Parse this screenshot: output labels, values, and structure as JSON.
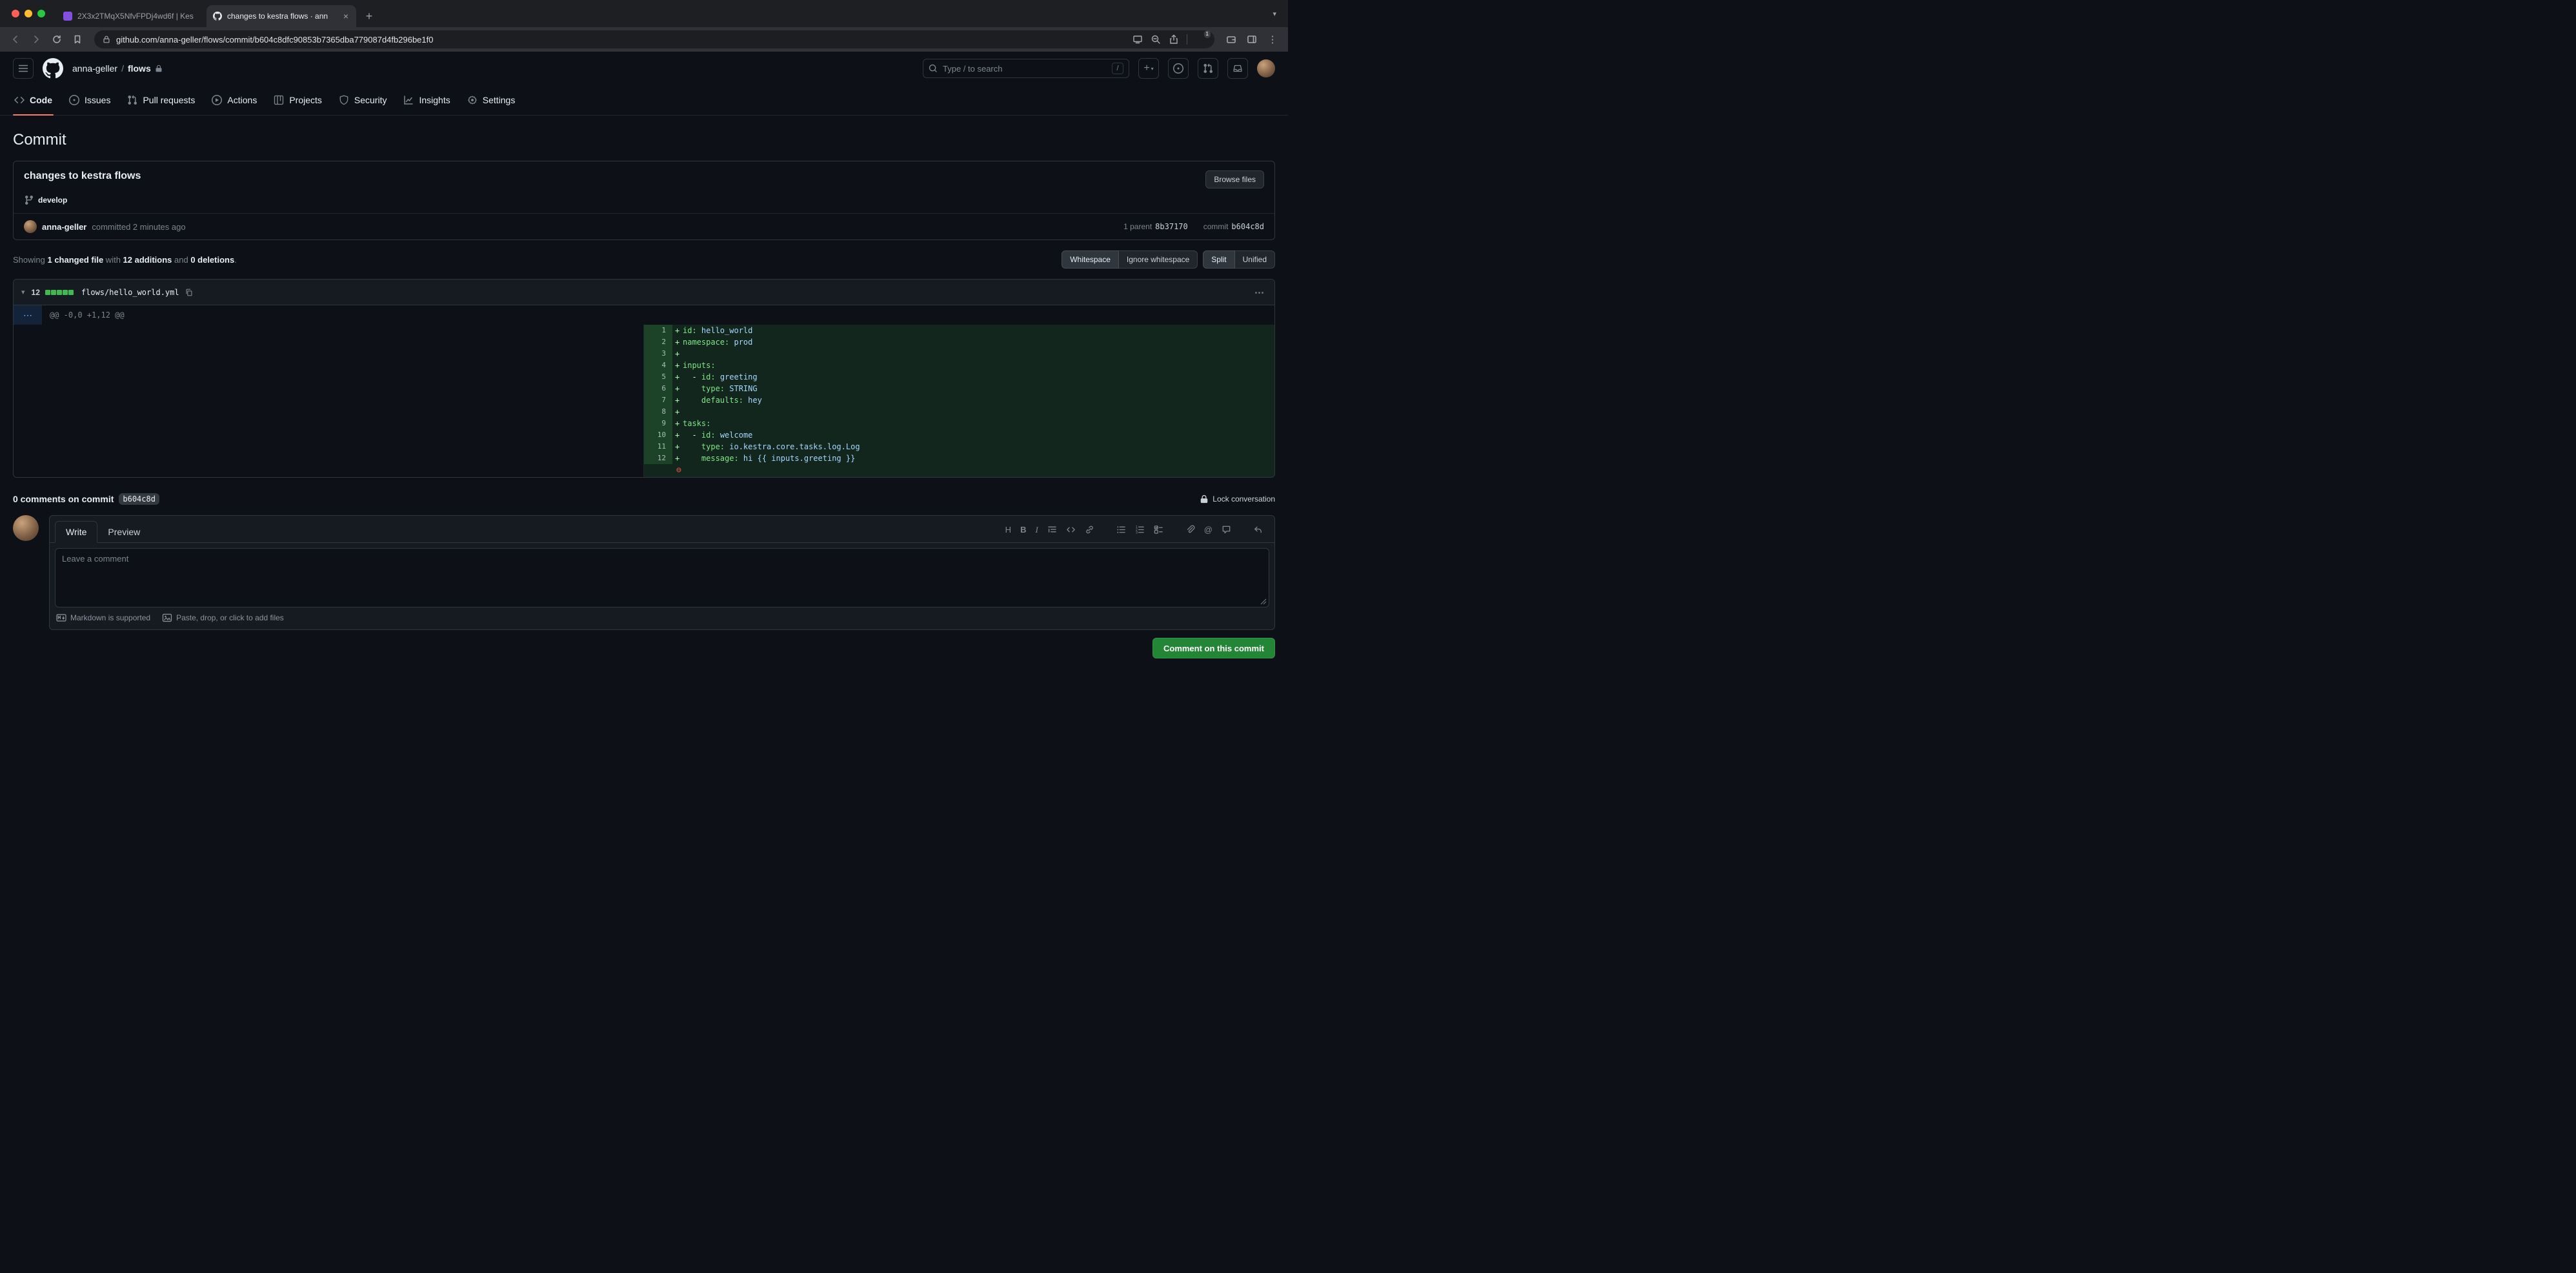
{
  "browser": {
    "tab1_title": "2X3x2TMqX5NfvFPDj4wd6f | Kes",
    "tab2_title": "changes to kestra flows · ann",
    "url": "github.com/anna-geller/flows/commit/b604c8dfc90853b7365dba779087d4fb296be1f0",
    "shields_badge": "1"
  },
  "icons": {
    "new_tab": "+",
    "tab_close": "×",
    "tabstrip_chevron": "▾",
    "overflow_menu": "⋮",
    "kebab": "⋯",
    "hunk_expand": "⋯",
    "collapse_chevron": "▾",
    "plus": "+",
    "caret_down": "▾",
    "no_newline": "⊖",
    "heading": "H",
    "bold": "B",
    "italic": "I",
    "mention": "@"
  },
  "gh_header": {
    "owner": "anna-geller",
    "sep": "/",
    "repo": "flows",
    "search_placeholder": "Type / to search",
    "search_kbd": "/"
  },
  "nav": {
    "items": [
      {
        "label": "Code"
      },
      {
        "label": "Issues"
      },
      {
        "label": "Pull requests"
      },
      {
        "label": "Actions"
      },
      {
        "label": "Projects"
      },
      {
        "label": "Security"
      },
      {
        "label": "Insights"
      },
      {
        "label": "Settings"
      }
    ]
  },
  "page": {
    "title": "Commit"
  },
  "commit": {
    "message": "changes to kestra flows",
    "browse_files": "Browse files",
    "branch": "develop",
    "author": "anna-geller",
    "meta": "committed 2 minutes ago",
    "parent_label": "1 parent",
    "parent_sha": "8b37170",
    "commit_label": "commit",
    "commit_sha": "b604c8d"
  },
  "summary": {
    "showing": "Showing ",
    "files": "1 changed file",
    "with": " with ",
    "additions": "12 additions",
    "and": " and ",
    "deletions": "0 deletions",
    "period": "."
  },
  "diff_controls": {
    "whitespace": "Whitespace",
    "ignore_whitespace": "Ignore whitespace",
    "split": "Split",
    "unified": "Unified"
  },
  "diff": {
    "changes_count": "12",
    "filename": "flows/hello_world.yml",
    "hunk": "@@ -0,0 +1,12 @@",
    "lines": [
      {
        "n": "1",
        "sign": "+",
        "pre": "",
        "key": "id:",
        "val": " hello_world"
      },
      {
        "n": "2",
        "sign": "+",
        "pre": "",
        "key": "namespace:",
        "val": " prod"
      },
      {
        "n": "3",
        "sign": "+",
        "pre": "",
        "key": "",
        "val": ""
      },
      {
        "n": "4",
        "sign": "+",
        "pre": "",
        "key": "inputs:",
        "val": ""
      },
      {
        "n": "5",
        "sign": "+",
        "pre": "  - ",
        "key": "id:",
        "val": " greeting"
      },
      {
        "n": "6",
        "sign": "+",
        "pre": "    ",
        "key": "type:",
        "val": " STRING"
      },
      {
        "n": "7",
        "sign": "+",
        "pre": "    ",
        "key": "defaults:",
        "val": " hey"
      },
      {
        "n": "8",
        "sign": "+",
        "pre": "",
        "key": "",
        "val": ""
      },
      {
        "n": "9",
        "sign": "+",
        "pre": "",
        "key": "tasks:",
        "val": ""
      },
      {
        "n": "10",
        "sign": "+",
        "pre": "  - ",
        "key": "id:",
        "val": " welcome"
      },
      {
        "n": "11",
        "sign": "+",
        "pre": "    ",
        "key": "type:",
        "val": " io.kestra.core.tasks.log.Log"
      },
      {
        "n": "12",
        "sign": "+",
        "pre": "    ",
        "key": "message:",
        "val": " hi {{ inputs.greeting }}"
      }
    ]
  },
  "comments": {
    "heading": "0 comments on commit",
    "sha": "b604c8d",
    "lock_label": "Lock conversation"
  },
  "composer": {
    "write_tab": "Write",
    "preview_tab": "Preview",
    "placeholder": "Leave a comment",
    "markdown_note": "Markdown is supported",
    "paste_note": "Paste, drop, or click to add files",
    "submit": "Comment on this commit"
  },
  "colors": {
    "addition_bg": "rgba(46,160,67,0.15)",
    "addition_gutter_bg": "rgba(63,185,80,0.3)",
    "primary_button": "#238636",
    "nav_underline": "#f78166",
    "brave_orange": "#fb542b",
    "diffstat_green": "#3fb950"
  }
}
